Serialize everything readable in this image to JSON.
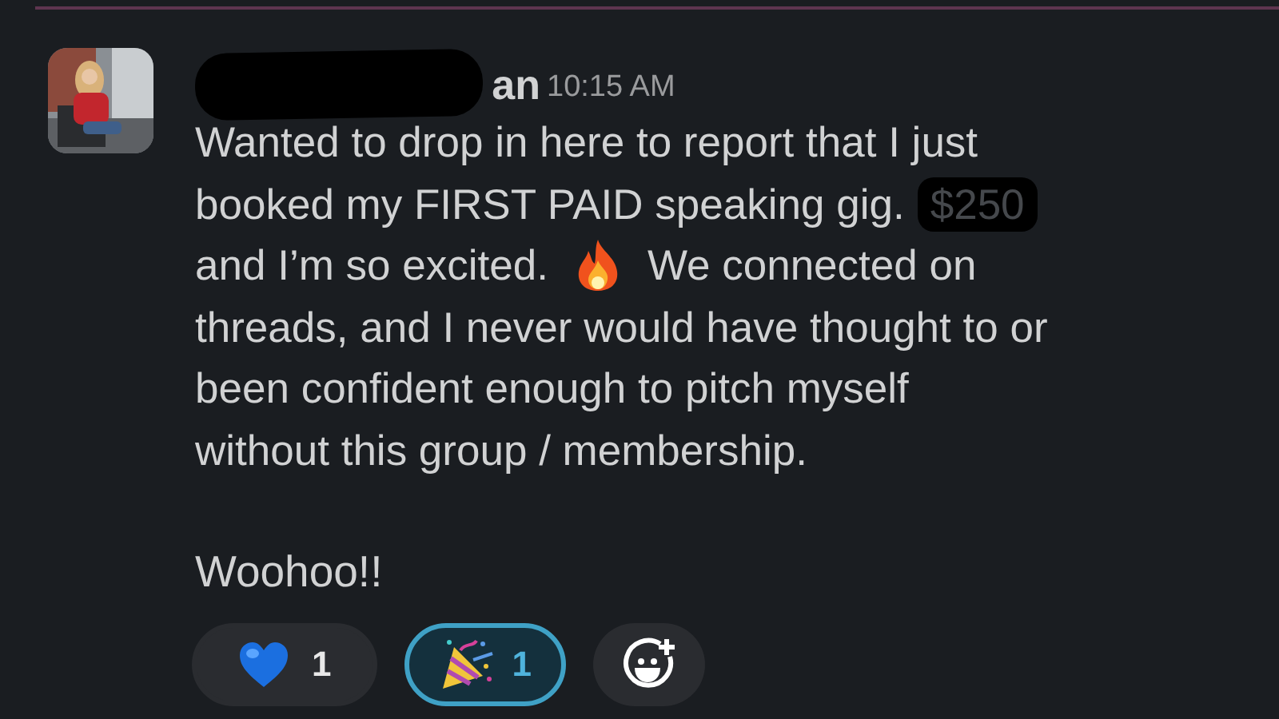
{
  "message": {
    "author": {
      "name_visible": "an",
      "redacted": true
    },
    "time": "10:15 AM",
    "lines": [
      [
        {
          "kind": "text",
          "text": "Wanted to drop in here to report that I just"
        }
      ],
      [
        {
          "kind": "text",
          "text": "booked my FIRST PAID speaking gig."
        },
        {
          "kind": "redacted",
          "text": "$250"
        }
      ],
      [
        {
          "kind": "text",
          "text": "and I’m so excited."
        },
        {
          "kind": "fire_emoji"
        },
        {
          "kind": "text",
          "text": "We connected on"
        }
      ],
      [
        {
          "kind": "text",
          "text": "threads, and I never would have thought to or"
        }
      ],
      [
        {
          "kind": "text",
          "text": "been confident enough to pitch myself"
        }
      ],
      [
        {
          "kind": "text",
          "text": "without this group / membership."
        }
      ]
    ],
    "closing": "Woohoo!!"
  },
  "reactions": [
    {
      "kind": "heart",
      "count": "1",
      "selected": false
    },
    {
      "kind": "party",
      "count": "1",
      "selected": true
    }
  ]
}
